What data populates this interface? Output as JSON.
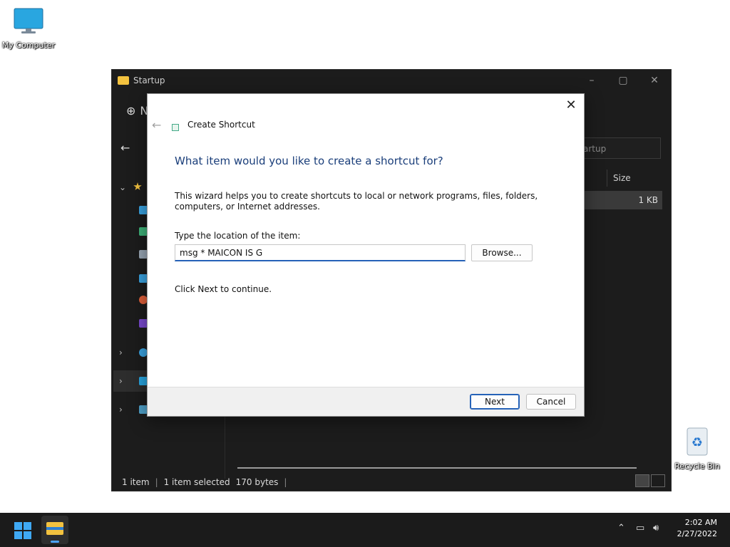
{
  "desktop": {
    "my_computer_label": "My Computer",
    "recycle_bin_label": "Recycle Bin"
  },
  "explorer": {
    "title": "Startup",
    "new_partial": "N",
    "search_placeholder_partial": "artup",
    "column_size": "Size",
    "file_size": "1 KB",
    "status": {
      "items": "1 item",
      "selected": "1 item selected",
      "bytes": "170 bytes"
    }
  },
  "dialog": {
    "title": "Create Shortcut",
    "heading": "What item would you like to create a shortcut for?",
    "description": "This wizard helps you to create shortcuts to local or network programs, files, folders, computers, or Internet addresses.",
    "location_label": "Type the location of the item:",
    "location_value": "msg * MAICON IS G",
    "browse_label": "Browse...",
    "hint": "Click Next to continue.",
    "next_label": "Next",
    "cancel_label": "Cancel",
    "close_glyph": "✕",
    "back_glyph": "←"
  },
  "taskbar": {
    "time": "2:02 AM",
    "date": "2/27/2022"
  },
  "colors": {
    "accent": "#2562b8",
    "heading": "#1a3e7a",
    "taskbar": "#1b1b1b",
    "explorer_bg": "#1c1c1c"
  }
}
